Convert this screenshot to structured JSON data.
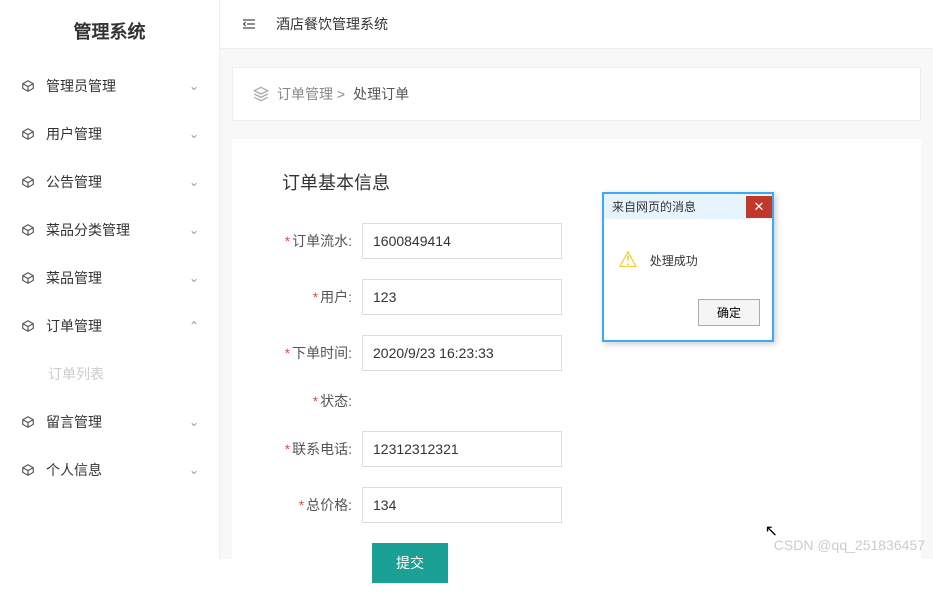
{
  "sidebar": {
    "title": "管理系统",
    "items": [
      {
        "label": "管理员管理",
        "expanded": false
      },
      {
        "label": "用户管理",
        "expanded": false
      },
      {
        "label": "公告管理",
        "expanded": false
      },
      {
        "label": "菜品分类管理",
        "expanded": false
      },
      {
        "label": "菜品管理",
        "expanded": false
      },
      {
        "label": "订单管理",
        "expanded": true,
        "sub": [
          {
            "label": "订单列表"
          }
        ]
      },
      {
        "label": "留言管理",
        "expanded": false
      },
      {
        "label": "个人信息",
        "expanded": false
      }
    ]
  },
  "header": {
    "title": "酒店餐饮管理系统"
  },
  "breadcrumb": {
    "part1": "订单管理 >",
    "part2": "处理订单"
  },
  "form": {
    "section_title": "订单基本信息",
    "fields": {
      "order_no": {
        "label": "订单流水:",
        "value": "1600849414"
      },
      "user": {
        "label": "用户:",
        "value": "123"
      },
      "time": {
        "label": "下单时间:",
        "value": "2020/9/23 16:23:33"
      },
      "status": {
        "label": "状态:",
        "value": ""
      },
      "phone": {
        "label": "联系电话:",
        "value": "12312312321"
      },
      "total": {
        "label": "总价格:",
        "value": "134"
      }
    },
    "submit_label": "提交"
  },
  "dialog": {
    "title": "来自网页的消息",
    "message": "处理成功",
    "ok_label": "确定"
  },
  "watermark": "CSDN @qq_251836457"
}
